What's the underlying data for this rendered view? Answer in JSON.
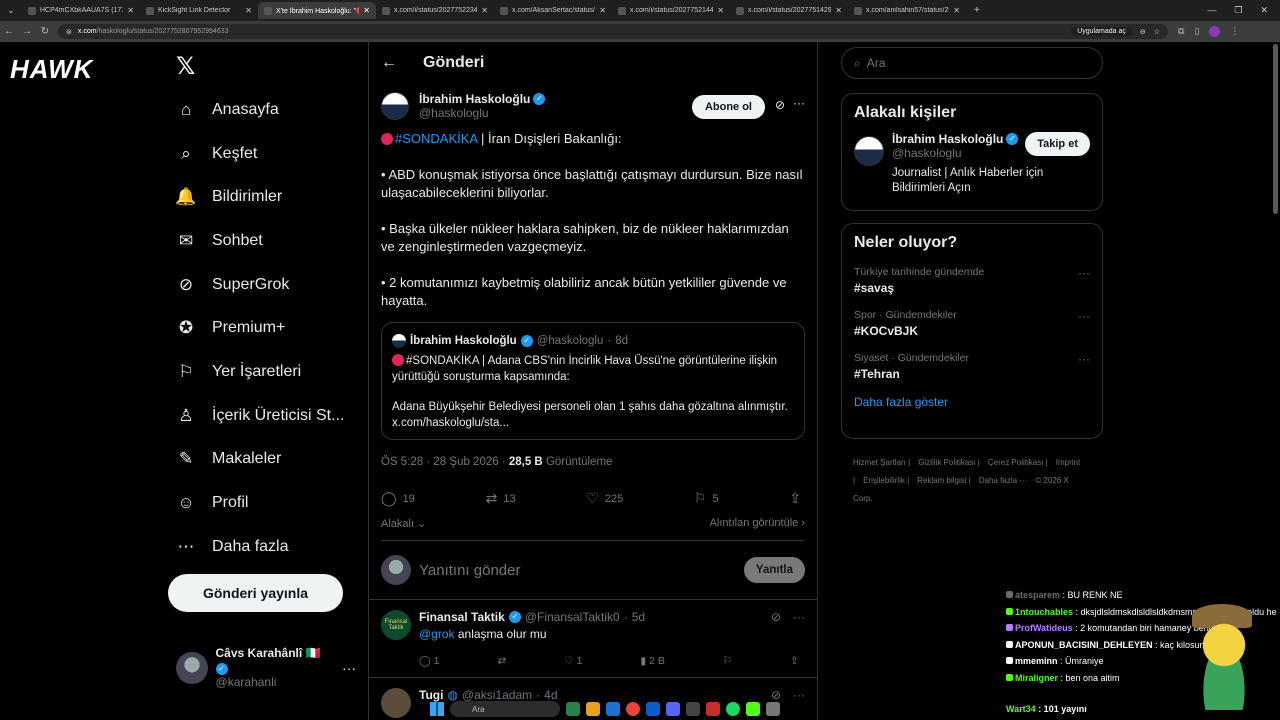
{
  "browser": {
    "tabs": [
      {
        "title": "HCP4mCXbkAAUA7S (1714×10",
        "active": false
      },
      {
        "title": "KickSight Link Detector",
        "active": false
      },
      {
        "title": "X'te İbrahim Haskoloğlu: \"🔴#",
        "active": true
      },
      {
        "title": "x.com/i/status/202775223468",
        "active": false
      },
      {
        "title": "x.com/AksanSertac/status/2027",
        "active": false
      },
      {
        "title": "x.com/i/status/202775214472",
        "active": false
      },
      {
        "title": "x.com/i/status/202775142986",
        "active": false
      },
      {
        "title": "x.com/anilsahin57/status/2027",
        "active": false
      }
    ],
    "url_host": "x.com",
    "url_path": "/haskologlu/status/2027752807952994633",
    "open_in_app": "Uygulamada aç"
  },
  "brand": {
    "hawk_logo": "HAWK",
    "x_logo": "𝕏"
  },
  "nav": {
    "items": [
      {
        "label": "Anasayfa",
        "icon": "home-icon",
        "glyph": "⌂"
      },
      {
        "label": "Keşfet",
        "icon": "search-icon",
        "glyph": "⌕"
      },
      {
        "label": "Bildirimler",
        "icon": "bell-icon",
        "glyph": "🔔"
      },
      {
        "label": "Sohbet",
        "icon": "mail-icon",
        "glyph": "✉"
      },
      {
        "label": "SuperGrok",
        "icon": "grok-icon",
        "glyph": "⊘"
      },
      {
        "label": "Premium+",
        "icon": "premium-icon",
        "glyph": "✪"
      },
      {
        "label": "Yer İşaretleri",
        "icon": "bookmark-icon",
        "glyph": "⚐"
      },
      {
        "label": "İçerik Üreticisi St...",
        "icon": "creator-icon",
        "glyph": "♙"
      },
      {
        "label": "Makaleler",
        "icon": "article-icon",
        "glyph": "✎"
      },
      {
        "label": "Profil",
        "icon": "profile-icon",
        "glyph": "☺"
      },
      {
        "label": "Daha fazla",
        "icon": "more-circle-icon",
        "glyph": "⋯"
      }
    ],
    "post_button": "Gönderi yayınla"
  },
  "account": {
    "name": "Câvs Karahânlî 🇮🇹",
    "handle": "@karahanli"
  },
  "main": {
    "title": "Gönderi",
    "tweet": {
      "author_name": "İbrahim Haskoloğlu",
      "author_handle": "@haskologlu",
      "subscribe": "Abone ol",
      "hashtag": "#SONDAKİKA",
      "lead": " | İran Dışişleri Bakanlığı:",
      "p1": "• ABD konuşmak istiyorsa önce başlattığı çatışmayı durdursun. Bize nasıl ulaşacabileceklerini biliyorlar.",
      "p2": "• Başka ülkeler nükleer haklara sahipken, biz de nükleer haklarımızdan ve zenginleştirmeden vazgeçmeyiz.",
      "p3": "• 2 komutanımızı kaybetmiş olabiliriz ancak bütün yetkililer güvende ve hayatta.",
      "quote": {
        "name": "İbrahim Haskoloğlu",
        "handle": "@haskologlu",
        "age": "8d",
        "text1": "#SONDAKİKA | Adana CBS'nin İncirlik Hava Üssü'ne görüntülerine ilişkin yürüttüğü soruşturma kapsamında:",
        "text2": "Adana Büyükşehir Belediyesi personeli olan 1 şahıs daha gözaltına alınmıştır.",
        "link": "x.com/haskologlu/sta..."
      },
      "time": "ÖS 5:28 · 28 Şub 2026 · ",
      "views": "28,5 B",
      "views_label": " Görüntüleme",
      "replies": "19",
      "reposts": "13",
      "likes": "225",
      "bookmarks": "5",
      "related": "Alakalı",
      "quotes_link": "Alıntılan görüntüle"
    },
    "reply_box": {
      "placeholder": "Yanıtını gönder",
      "button": "Yanıtla"
    },
    "replies": [
      {
        "name": "Finansal Taktik",
        "handle": "@FinansalTaktik0",
        "age": "5d",
        "mention": "@grok",
        "text": " anlaşma olur mu",
        "avatar_text": "Finansal Taktik",
        "replies": "1",
        "reposts": "",
        "likes": "1",
        "views": "2 B"
      },
      {
        "name": "Tugi",
        "handle": "@aksi1adam",
        "age": "4d"
      }
    ]
  },
  "sidebar": {
    "search_placeholder": "Ara",
    "people_title": "Alakalı kişiler",
    "person": {
      "name": "İbrahim Haskoloğlu",
      "handle": "@haskologlu",
      "bio": "Journalist | Anlık Haberler için Bildirimleri Açın",
      "follow": "Takip et"
    },
    "trends_title": "Neler oluyor?",
    "trends": [
      {
        "context": "Türkiye tarihinde gündemde",
        "name": "#savaş"
      },
      {
        "context": "Spor · Gündemdekiler",
        "name": "#KOCvBJK"
      },
      {
        "context": "Siyaset · Gündemdekiler",
        "name": "#Tehran"
      }
    ],
    "show_more": "Daha fazla göster",
    "footer": [
      "Hizmet Şartları |",
      "Gizlilik Politikası |",
      "Çerez Politikası |",
      "Imprint |",
      "Erişilebilirlik |",
      "Reklam bilgisi |",
      "Daha fazla ···",
      "© 2026 X Corp."
    ]
  },
  "chat": {
    "lines": [
      {
        "user": "atesparem",
        "text": " : BU RENK NE",
        "color": "#6b6b6b"
      },
      {
        "user": "1ntouchables",
        "text": " : dksjdlsldmskdlsldlsldkdmsmsmsyaygüzel oldu he",
        "color": "#53fc18"
      },
      {
        "user": "ProfWatideus",
        "text": " : 2 komutandan biri hamaney bence",
        "color": "#b57cff"
      },
      {
        "user": "APONUN_BACISINI_DEHLEYEN",
        "text": " : kaç kilosun",
        "color": "#ffffff"
      },
      {
        "user": "mmeminn",
        "text": " : Ümraniye",
        "color": "#ffffff"
      },
      {
        "user": "Miraligner",
        "text": " : ben ona aitim",
        "color": "#53fc18"
      }
    ],
    "footer_user": "Wart34",
    "footer_text": " : 101 yayını"
  },
  "taskbar": {
    "search": "Ara"
  }
}
